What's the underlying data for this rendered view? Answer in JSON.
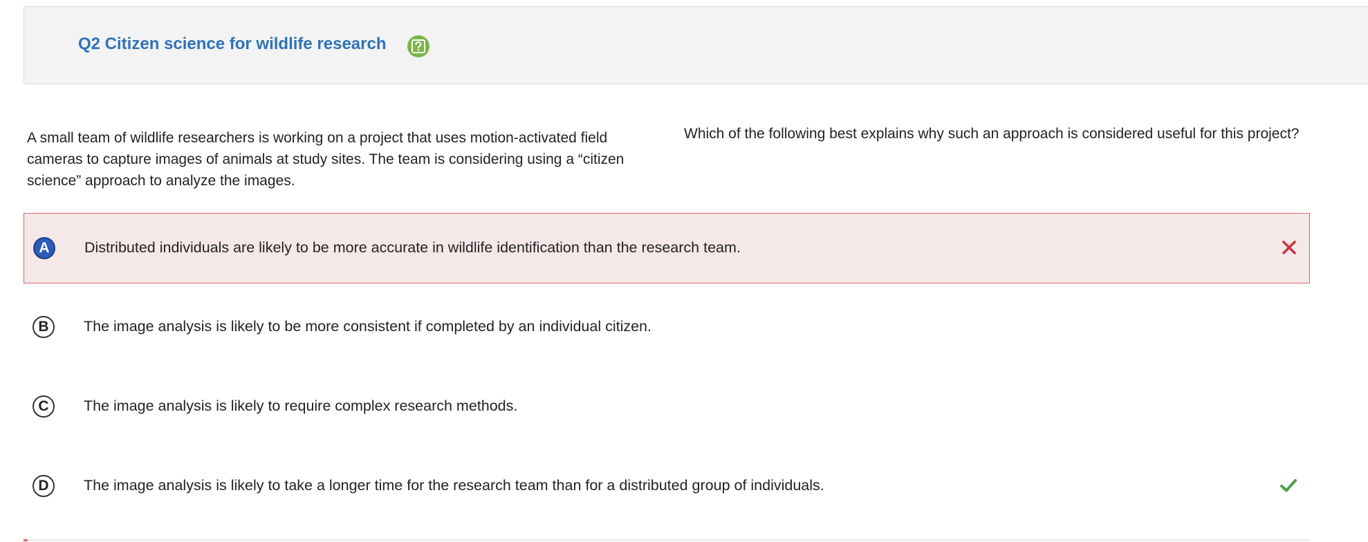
{
  "question": {
    "title": "Q2 Citizen science for wildlife research",
    "stem": "A small team of wildlife researchers is working on a project that uses motion-activated field cameras to capture images of animals at study sites. The team is considering using a “citizen science” approach to analyze the images.",
    "prompt": "Which of the following best explains why such an approach is considered useful for this project?"
  },
  "choices": [
    {
      "letter": "A",
      "text": "Distributed individuals are likely to be more accurate in wildlife identification than the research team.",
      "status": "selected-incorrect",
      "mark_icon": "x-icon"
    },
    {
      "letter": "B",
      "text": "The image analysis is likely to be more consistent if completed by an individual citizen.",
      "status": "unselected"
    },
    {
      "letter": "C",
      "text": "The image analysis is likely to require complex research methods.",
      "status": "unselected"
    },
    {
      "letter": "D",
      "text": "The image analysis is likely to take a longer time for the research team than for a distributed group of individuals.",
      "status": "correct",
      "mark_icon": "checkmark-icon"
    }
  ],
  "icons": {
    "help": "help-icon"
  },
  "colors": {
    "title": "#2f72b8",
    "help_badge": "#7ab648",
    "incorrect": "#c8363f",
    "incorrect_bg": "#f4e8e9",
    "incorrect_border": "#e0616b",
    "correct": "#4ea24a",
    "selected_letter": "#2e5bb8"
  }
}
